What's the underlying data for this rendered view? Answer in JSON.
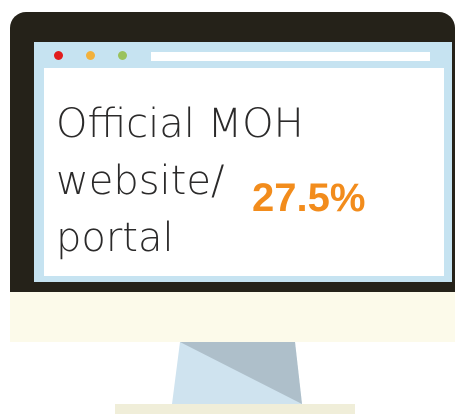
{
  "colors": {
    "frame": "#252219",
    "screen": "#c6e3f1",
    "dot_red": "#e11d1d",
    "dot_yellow": "#f2b13c",
    "dot_green": "#9ac25c",
    "accent_orange": "#f28c1c",
    "chin": "#fcfaea",
    "stand_light": "#cfe3ef",
    "stand_dark": "#aebfca"
  },
  "content": {
    "label_lines": [
      "Official MOH",
      "website/",
      "portal"
    ],
    "percentage": "27.5%"
  }
}
